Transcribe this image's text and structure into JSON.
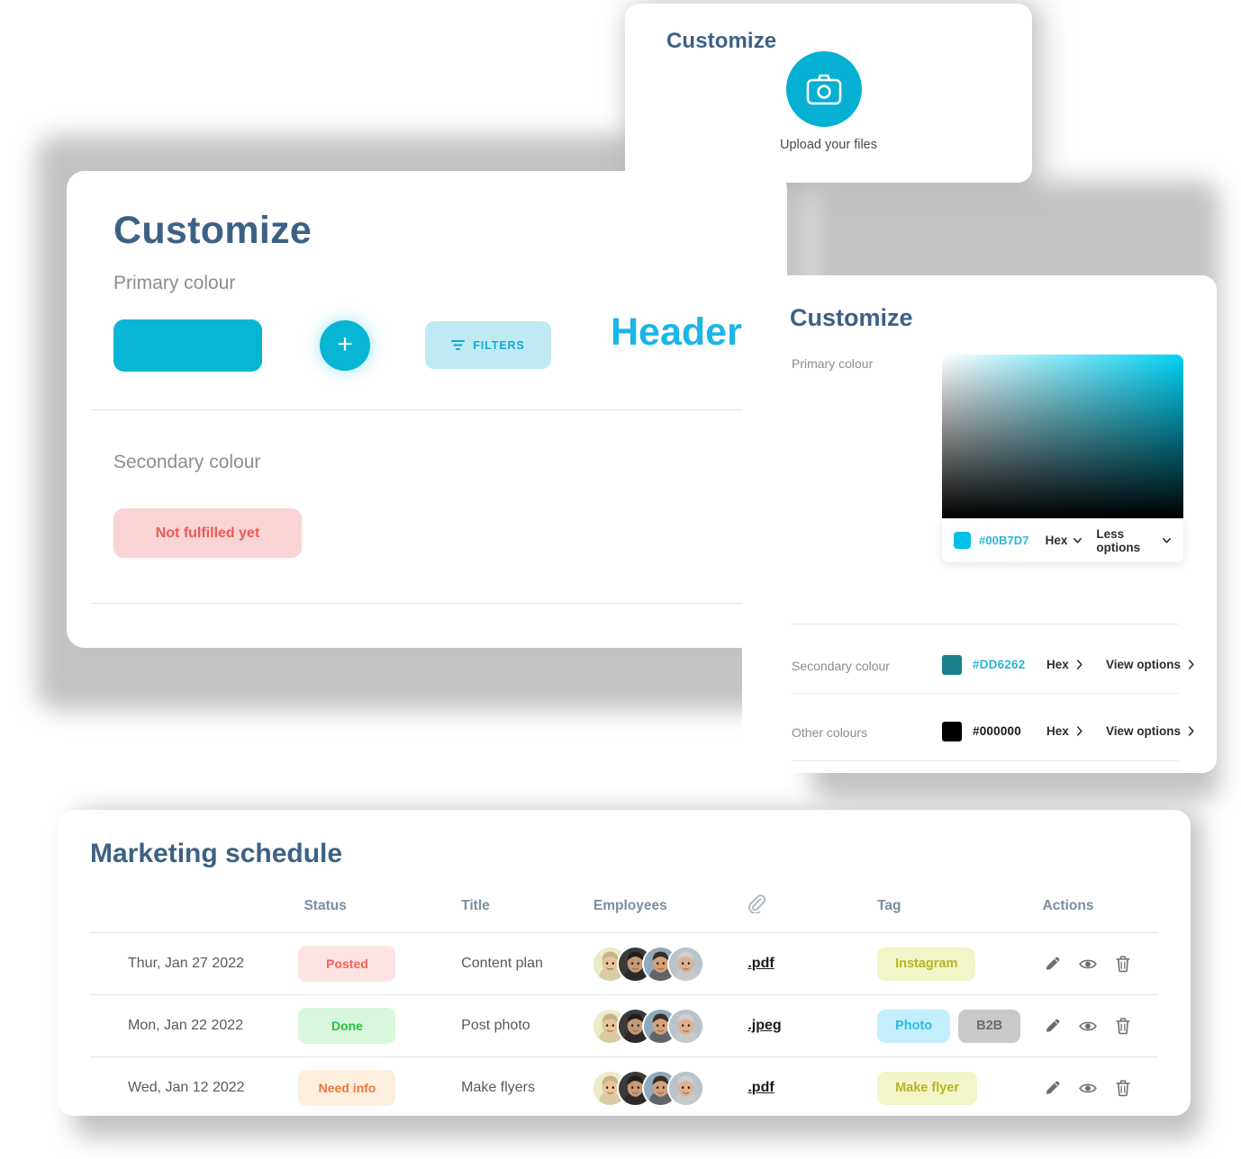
{
  "upload_card": {
    "title": "Customize",
    "icon": "camera-icon",
    "upload_label": "Upload your files"
  },
  "main_card": {
    "title": "Customize",
    "primary_label": "Primary colour",
    "secondary_label": "Secondary colour",
    "primary_swatch_color": "#06B6D4",
    "add_button_icon": "plus-icon",
    "filters_button": {
      "label": "FILTERS",
      "icon": "filter-icon"
    },
    "headers_text": "Headers",
    "headers_color": "#1AB6E8",
    "secondary_pill": {
      "label": "Not fulfilled yet",
      "bg": "#FAD4D4",
      "fg": "#EA5A5A"
    }
  },
  "picker_card": {
    "title": "Customize",
    "primary_label": "Primary colour",
    "gradient_hue": "#00D2F5",
    "primary_footer": {
      "swatch": "#00C2E8",
      "hex": "#00B7D7",
      "format_label": "Hex",
      "options_label": "Less options",
      "chevron": "chevron-down-icon"
    },
    "rows": [
      {
        "label": "Secondary colour",
        "swatch": "#1A7E8C",
        "hex": "#DD6262",
        "hex_color": "#2AB4DA",
        "format_label": "Hex",
        "action_label": "View options",
        "chevron": "chevron-right-icon"
      },
      {
        "label": "Other colours",
        "swatch": "#000000",
        "hex": "#000000",
        "hex_color": "#1A1A1A",
        "format_label": "Hex",
        "action_label": "View options",
        "chevron": "chevron-right-icon"
      }
    ]
  },
  "schedule_card": {
    "title": "Marketing schedule",
    "columns": [
      {
        "key": "date",
        "label": ""
      },
      {
        "key": "status",
        "label": "Status"
      },
      {
        "key": "title",
        "label": "Title"
      },
      {
        "key": "employees",
        "label": "Employees"
      },
      {
        "key": "file",
        "label": "",
        "icon": "paperclip-icon"
      },
      {
        "key": "tag",
        "label": "Tag"
      },
      {
        "key": "actions",
        "label": "Actions"
      }
    ],
    "rows": [
      {
        "date": "Thur, Jan 27 2022",
        "status": {
          "label": "Posted",
          "style": "st-posted"
        },
        "title": "Content plan",
        "employee_count": 4,
        "file": ".pdf",
        "tags": [
          {
            "label": "Instagram",
            "style": "tg-yellow"
          }
        ],
        "actions": [
          "edit-icon",
          "view-icon",
          "delete-icon"
        ]
      },
      {
        "date": "Mon, Jan 22 2022",
        "status": {
          "label": "Done",
          "style": "st-done"
        },
        "title": "Post photo",
        "employee_count": 4,
        "file": ".jpeg",
        "tags": [
          {
            "label": "Photo",
            "style": "tg-blue"
          },
          {
            "label": "B2B",
            "style": "tg-grey"
          }
        ],
        "actions": [
          "edit-icon",
          "view-icon",
          "delete-icon"
        ]
      },
      {
        "date": "Wed, Jan 12 2022",
        "status": {
          "label": "Need info",
          "style": "st-needinfo"
        },
        "title": "Make flyers",
        "employee_count": 4,
        "file": ".pdf",
        "tags": [
          {
            "label": "Make flyer",
            "style": "tg-yellow"
          }
        ],
        "actions": [
          "edit-icon",
          "view-icon",
          "delete-icon"
        ]
      }
    ]
  }
}
